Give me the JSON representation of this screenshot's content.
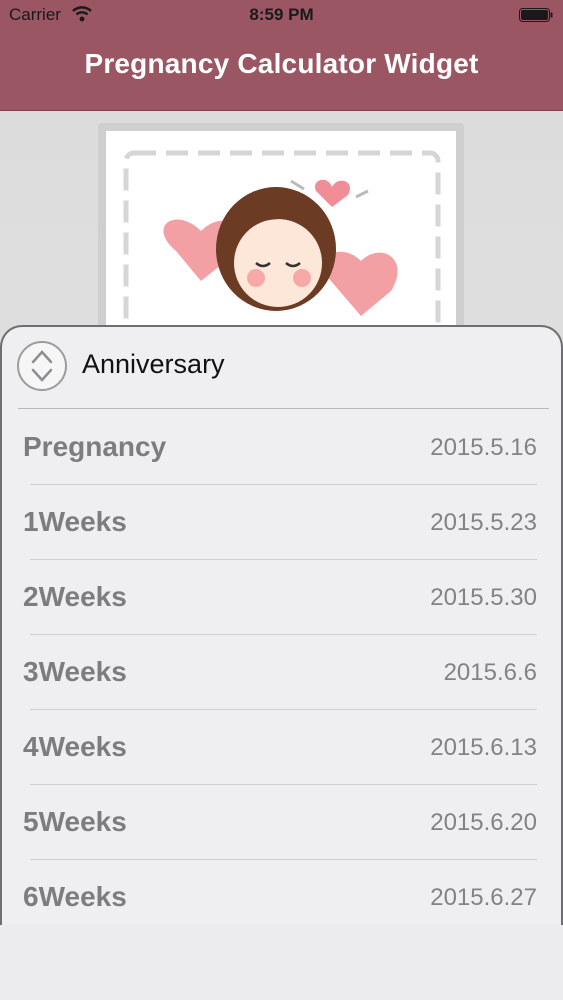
{
  "status_bar": {
    "carrier": "Carrier",
    "time": "8:59 PM"
  },
  "nav": {
    "title": "Pregnancy Calculator Widget"
  },
  "colors": {
    "header": "#9a5663",
    "sheet": "#efeff1",
    "label": "#7d7d80"
  },
  "panel": {
    "title": "Anniversary",
    "rows": [
      {
        "label": "Pregnancy",
        "date": "2015.5.16"
      },
      {
        "label": "1Weeks",
        "date": "2015.5.23"
      },
      {
        "label": "2Weeks",
        "date": "2015.5.30"
      },
      {
        "label": "3Weeks",
        "date": "2015.6.6"
      },
      {
        "label": "4Weeks",
        "date": "2015.6.13"
      },
      {
        "label": "5Weeks",
        "date": "2015.6.20"
      },
      {
        "label": "6Weeks",
        "date": "2015.6.27"
      }
    ]
  }
}
